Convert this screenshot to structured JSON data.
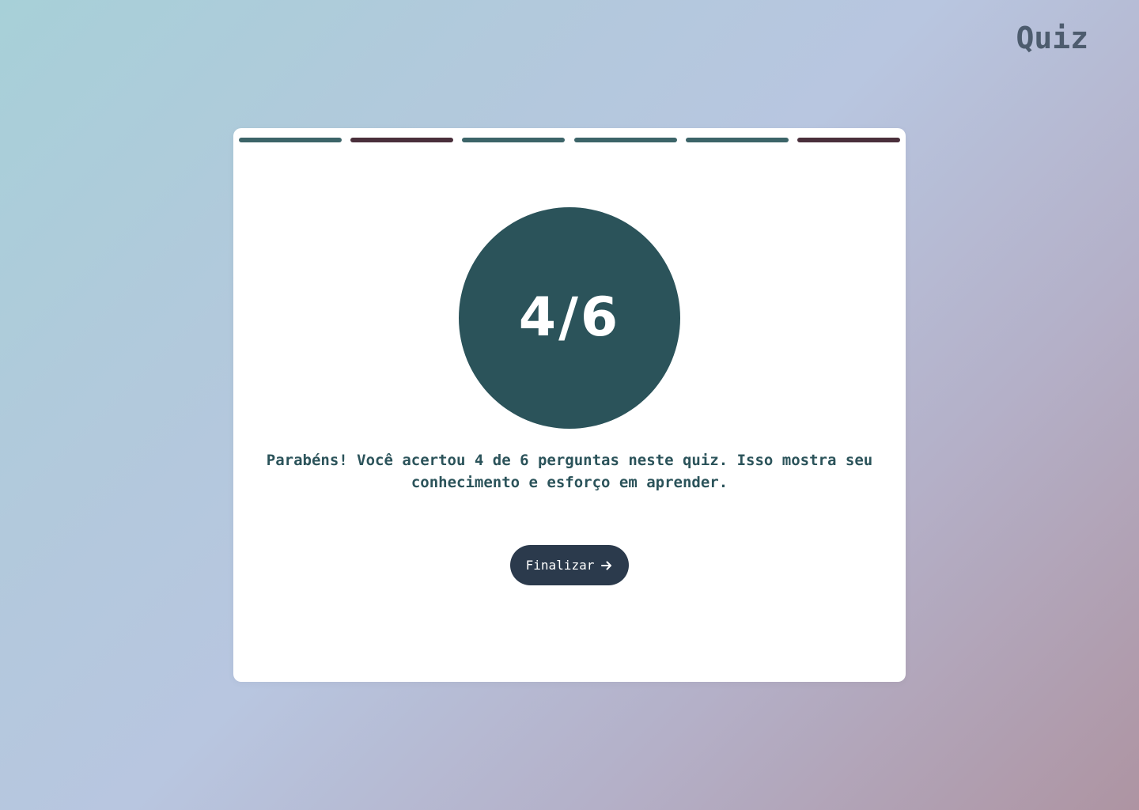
{
  "header": {
    "brand": "Quiz"
  },
  "progress": {
    "segments": [
      {
        "status": "correct",
        "color": "#3c6468"
      },
      {
        "status": "wrong",
        "color": "#4a2f3b"
      },
      {
        "status": "correct",
        "color": "#3c6468"
      },
      {
        "status": "correct",
        "color": "#3c6468"
      },
      {
        "status": "correct",
        "color": "#3c6468"
      },
      {
        "status": "wrong",
        "color": "#4a2f3b"
      }
    ]
  },
  "result": {
    "score": "4/6",
    "message": "Parabéns! Você acertou 4 de 6 perguntas neste quiz. Isso mostra seu conhecimento e esforço em aprender."
  },
  "actions": {
    "finish_label": "Finalizar",
    "finish_icon": "arrow-right-icon"
  },
  "colors": {
    "accent": "#2b535a",
    "button": "#2b3a4c",
    "correct": "#3c6468",
    "wrong": "#4a2f3b"
  }
}
